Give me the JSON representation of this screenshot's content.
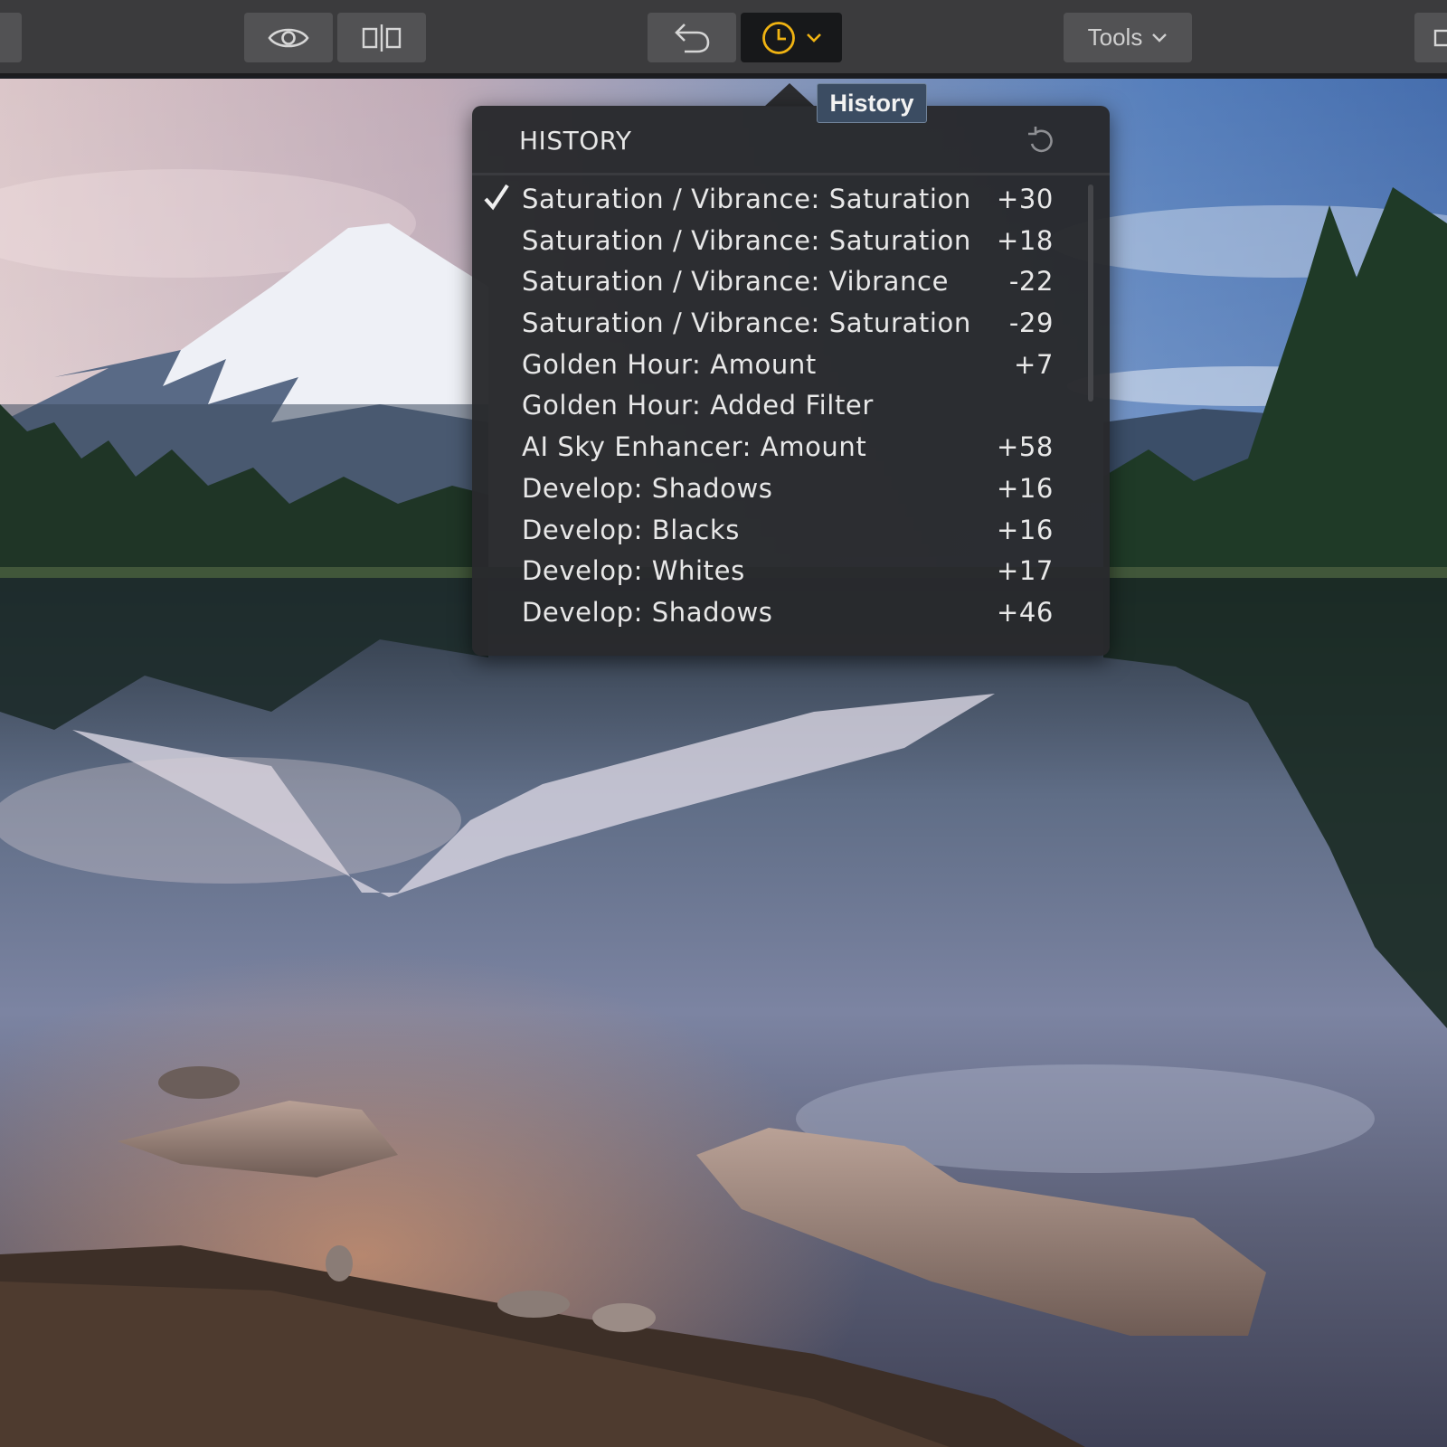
{
  "toolbar": {
    "left_stub_icon": "panel-toggle-icon",
    "eye_icon": "eye-icon",
    "compare_icon": "compare-icon",
    "undo_icon": "undo-icon",
    "history_icon": "clock-icon",
    "history_dropdown_icon": "chevron-down-icon",
    "tools_label": "Tools",
    "tools_icon": "chevron-down-icon",
    "right_stub_icon": "panel-toggle-icon",
    "accent_color": "#f0b312"
  },
  "tooltip": {
    "text": "History"
  },
  "history": {
    "title": "HISTORY",
    "reset_icon": "reset-icon",
    "items": [
      {
        "label": "Saturation / Vibrance: Saturation",
        "value": "+30",
        "checked": true
      },
      {
        "label": "Saturation / Vibrance: Saturation",
        "value": "+18"
      },
      {
        "label": "Saturation / Vibrance: Vibrance",
        "value": "-22"
      },
      {
        "label": "Saturation / Vibrance: Saturation",
        "value": "-29"
      },
      {
        "label": "Golden Hour: Amount",
        "value": "+7"
      },
      {
        "label": "Golden Hour: Added Filter",
        "value": ""
      },
      {
        "label": "AI Sky Enhancer: Amount",
        "value": "+58"
      },
      {
        "label": "Develop: Shadows",
        "value": "+16"
      },
      {
        "label": "Develop: Blacks",
        "value": "+16"
      },
      {
        "label": "Develop: Whites",
        "value": "+17"
      },
      {
        "label": "Develop: Shadows",
        "value": "+46"
      }
    ]
  }
}
